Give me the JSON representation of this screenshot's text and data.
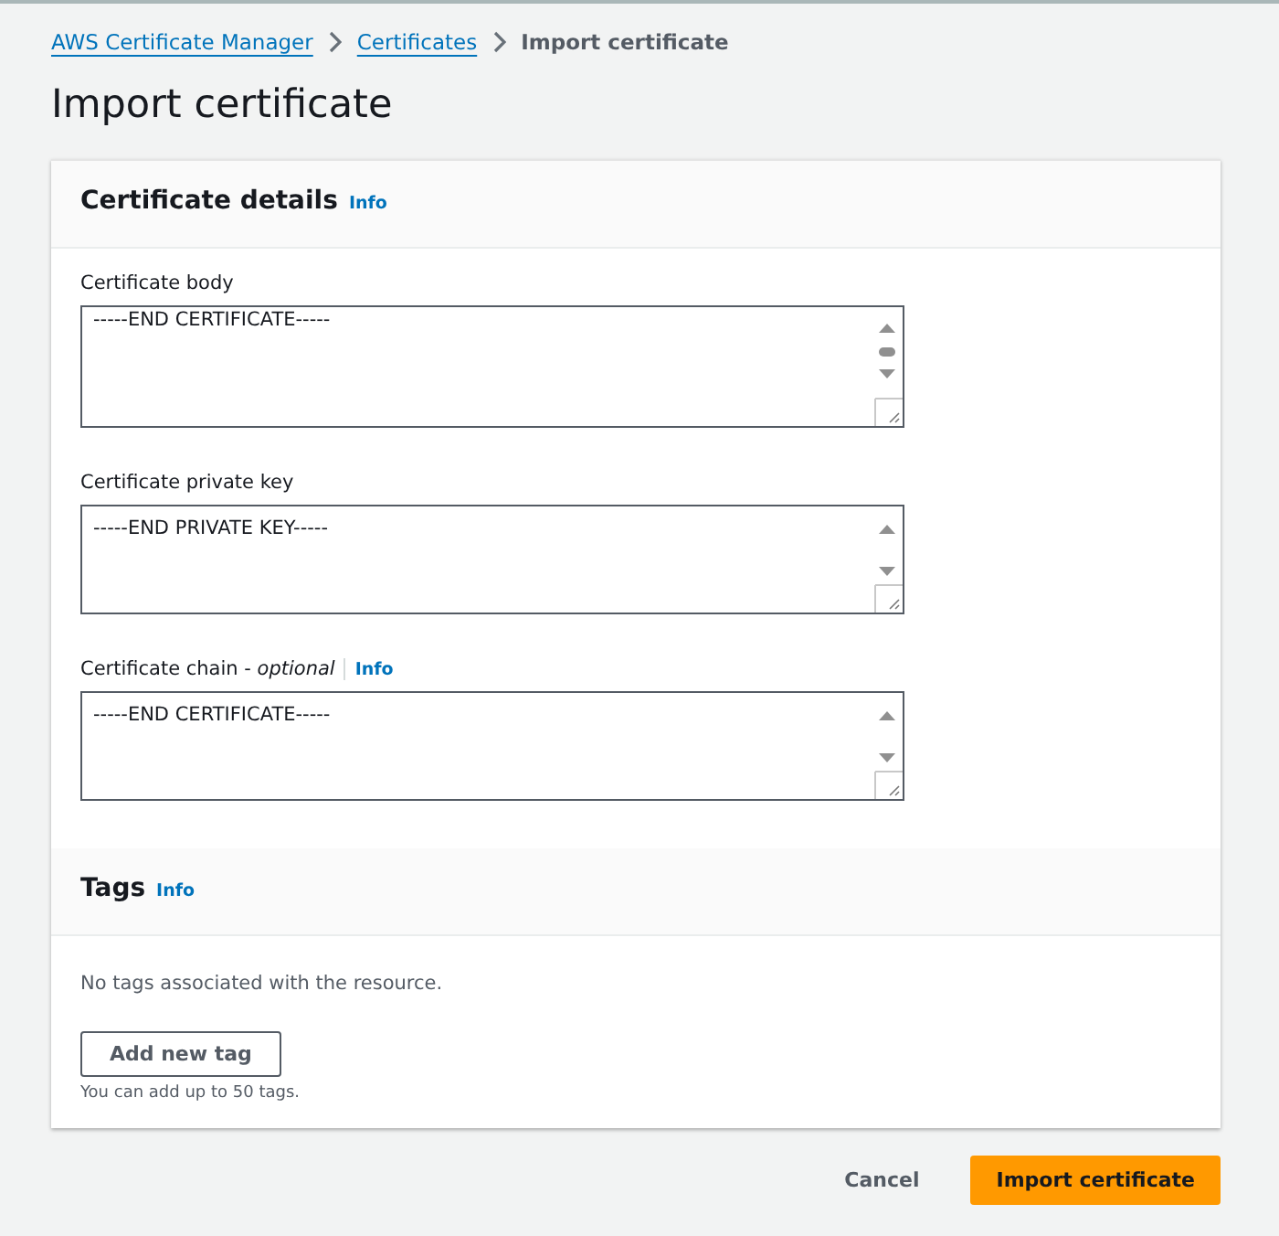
{
  "breadcrumbs": [
    {
      "label": "AWS Certificate Manager",
      "kind": "link"
    },
    {
      "label": "Certificates",
      "kind": "link"
    },
    {
      "label": "Import certificate",
      "kind": "current"
    }
  ],
  "title": "Import certificate",
  "certificate_details": {
    "heading": "Certificate details",
    "info": "Info",
    "fields": [
      {
        "label": "Certificate body",
        "value": "-----END CERTIFICATE-----",
        "scroll_thumb": true
      },
      {
        "label": "Certificate private key",
        "value": "-----END PRIVATE KEY-----",
        "scroll_thumb": false
      },
      {
        "label": "Certificate chain - *optional*",
        "info": "Info",
        "value": "-----END CERTIFICATE-----",
        "scroll_thumb": false
      }
    ]
  },
  "tags": {
    "heading": "Tags",
    "info": "Info",
    "empty_text": "No tags associated with the resource.",
    "add_button": "Add new tag",
    "hint": "You can add up to 50 tags."
  },
  "footer": {
    "cancel": "Cancel",
    "submit": "Import certificate"
  }
}
